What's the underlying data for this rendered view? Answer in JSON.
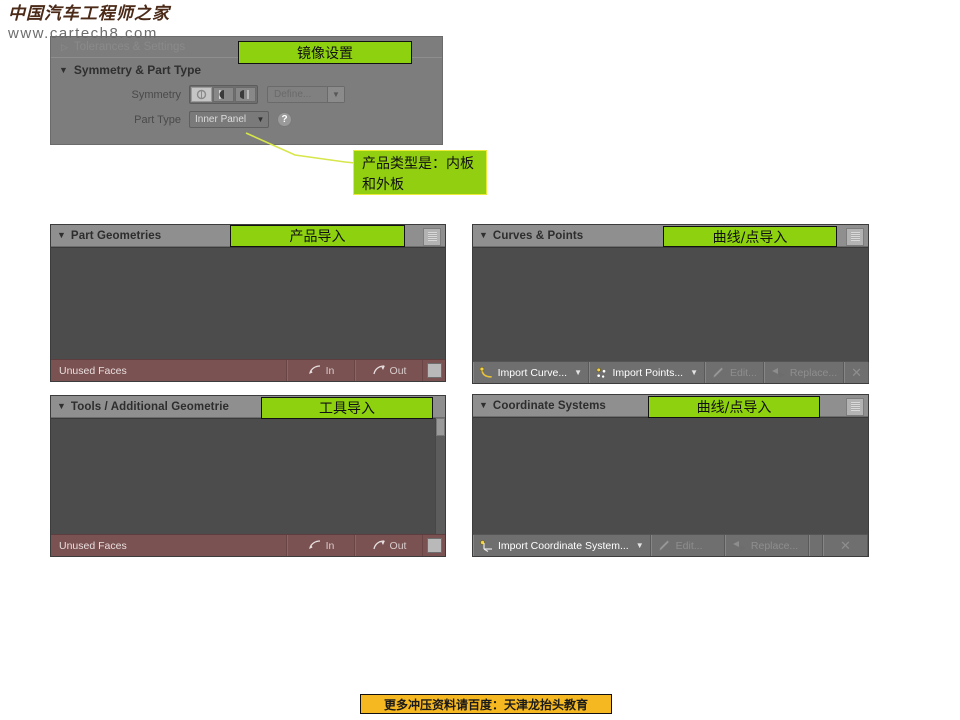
{
  "watermark": {
    "site_name_cn": "中国汽车工程师之家",
    "site_url": "www.cartech8.com"
  },
  "settings_panel": {
    "collapsed_section": {
      "label": "Tolerances & Settings",
      "triangle": "collapsed-triangle-icon"
    },
    "section": {
      "label": "Symmetry & Part Type",
      "triangle": "expanded-triangle-icon"
    },
    "symmetry": {
      "label": "Symmetry",
      "options": [
        "symmetry-none",
        "symmetry-left",
        "symmetry-right"
      ],
      "selected_index": 0,
      "define_button": {
        "label": "Define...",
        "caret": "▼",
        "disabled": true
      }
    },
    "part_type": {
      "label": "Part Type",
      "value": "Inner Panel",
      "caret": "▼",
      "help": "?"
    }
  },
  "annotations": {
    "mirror_settings": "镜像设置",
    "part_type_note": "产品类型是：内板和外板",
    "product_import": "产品导入",
    "curves_points_import": "曲线/点导入",
    "tools_import": "工具导入",
    "coord_import": "曲线/点导入"
  },
  "panels": {
    "part_geometries": {
      "title": "Part Geometries",
      "triangle": "▼",
      "header_button": "list-view-icon",
      "footer": {
        "status": "Unused Faces",
        "in_label": "In",
        "out_label": "Out",
        "in_icon": "arrow-in-icon",
        "out_icon": "arrow-out-icon",
        "square_icon": "toggle-square-icon"
      }
    },
    "curves_points": {
      "title": "Curves & Points",
      "triangle": "▼",
      "header_button": "list-view-icon",
      "footer": {
        "import_curve": "Import Curve...",
        "import_points": "Import Points...",
        "edit": "Edit...",
        "replace": "Replace...",
        "delete": "✕",
        "curve_icon": "import-curve-icon",
        "points_icon": "import-points-icon",
        "edit_icon": "pencil-icon",
        "replace_icon": "replace-icon",
        "caret": "▼"
      }
    },
    "tools_additional": {
      "title": "Tools / Additional Geometrie",
      "triangle": "▼",
      "scrollbar": "vertical-scrollbar",
      "footer": {
        "status": "Unused Faces",
        "in_label": "In",
        "out_label": "Out",
        "in_icon": "arrow-in-icon",
        "out_icon": "arrow-out-icon",
        "square_icon": "toggle-square-icon"
      }
    },
    "coordinate_systems": {
      "title": "Coordinate Systems",
      "triangle": "▼",
      "header_button": "list-view-icon",
      "footer": {
        "import_cs": "Import Coordinate System...",
        "edit": "Edit...",
        "replace": "Replace...",
        "delete": "✕",
        "cs_icon": "import-coordinate-system-icon",
        "edit_icon": "pencil-icon",
        "replace_icon": "replace-icon",
        "caret": "▼"
      }
    }
  },
  "bottom_banner": {
    "text": "更多冲压资料请百度：天津龙抬头教育"
  },
  "colors": {
    "annotation_green": "#8ed10e",
    "banner_orange": "#f5b820",
    "panel_body": "#4c4c4c",
    "panel_header": "#8f8f8f",
    "footer_red": "#7b5252",
    "leader_line": "#d7e64a"
  }
}
